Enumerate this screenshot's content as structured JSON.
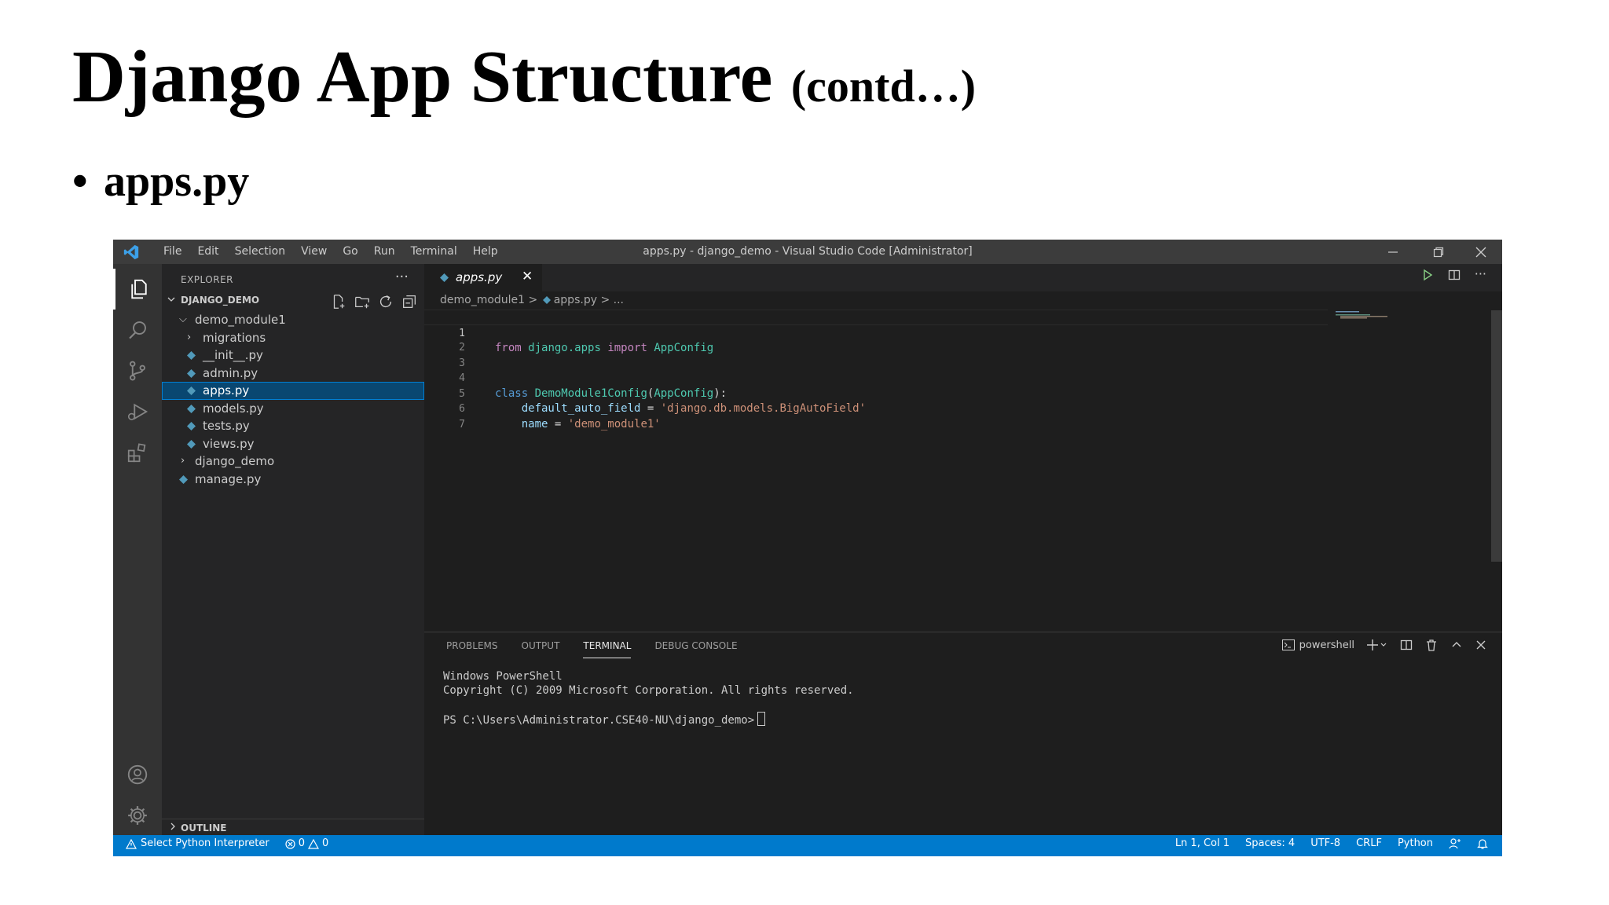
{
  "slide": {
    "title": "Django App Structure",
    "title_suffix": "(contd…)",
    "bullet": "apps.py"
  },
  "titlebar": {
    "menu": [
      "File",
      "Edit",
      "Selection",
      "View",
      "Go",
      "Run",
      "Terminal",
      "Help"
    ],
    "window_title": "apps.py - django_demo - Visual Studio Code [Administrator]"
  },
  "explorer": {
    "header": "EXPLORER",
    "more": "···",
    "project": "DJANGO_DEMO",
    "tree": [
      {
        "name": "demo_module1",
        "type": "folder-open",
        "level": 1
      },
      {
        "name": "migrations",
        "type": "folder-closed",
        "level": 2
      },
      {
        "name": "__init__.py",
        "type": "py",
        "level": 2
      },
      {
        "name": "admin.py",
        "type": "py",
        "level": 2
      },
      {
        "name": "apps.py",
        "type": "py",
        "level": 2,
        "selected": true
      },
      {
        "name": "models.py",
        "type": "py",
        "level": 2
      },
      {
        "name": "tests.py",
        "type": "py",
        "level": 2
      },
      {
        "name": "views.py",
        "type": "py",
        "level": 2
      },
      {
        "name": "django_demo",
        "type": "folder-closed",
        "level": 1
      },
      {
        "name": "manage.py",
        "type": "py",
        "level": 1
      }
    ],
    "outline": "OUTLINE"
  },
  "editor": {
    "tab_label": "apps.py",
    "breadcrumb": {
      "folder": "demo_module1",
      "sep": ">",
      "file": "apps.py",
      "tail": "> ..."
    },
    "line_numbers": [
      "1",
      "2",
      "3",
      "4",
      "5",
      "6",
      "7"
    ],
    "code": {
      "l1": {
        "from": "from",
        "module": "django.apps",
        "import": "import",
        "name": "AppConfig"
      },
      "l4": {
        "class": "class",
        "classname": "DemoModule1Config",
        "open": "(",
        "base": "AppConfig",
        "close": "):"
      },
      "l5": {
        "var": "default_auto_field",
        "eq": " = ",
        "value": "'django.db.models.BigAutoField'"
      },
      "l6": {
        "var": "name",
        "eq": " = ",
        "value": "'demo_module1'"
      }
    }
  },
  "panel": {
    "tabs": [
      "PROBLEMS",
      "OUTPUT",
      "TERMINAL",
      "DEBUG CONSOLE"
    ],
    "active_tab": "TERMINAL",
    "shell": "powershell",
    "terminal_lines": [
      "Windows PowerShell",
      "Copyright (C) 2009 Microsoft Corporation. All rights reserved.",
      "",
      "PS C:\\Users\\Administrator.CSE40-NU\\django_demo>"
    ]
  },
  "statusbar": {
    "interpreter": "Select Python Interpreter",
    "errors": "0",
    "warnings": "0",
    "position": "Ln 1, Col 1",
    "spaces": "Spaces: 4",
    "encoding": "UTF-8",
    "eol": "CRLF",
    "language": "Python"
  },
  "colors": {
    "titlebar": "#3c3c3c",
    "activitybar": "#333333",
    "sidebar": "#252526",
    "editor": "#1e1e1e",
    "statusbar": "#007acc",
    "selection": "#094771"
  }
}
